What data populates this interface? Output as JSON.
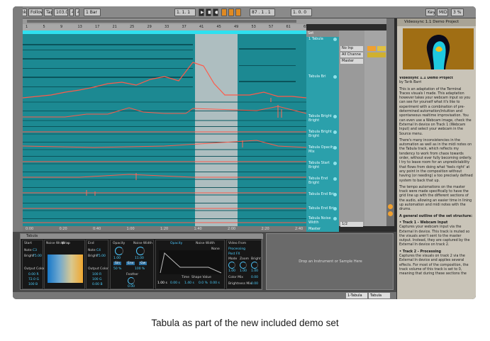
{
  "toolbar": {
    "link": "Link",
    "follow": "Follow",
    "tap": "Tap",
    "tempo": "103.00",
    "sig_num": "4",
    "sig_den": "4",
    "quant": "1 Bar",
    "pos": "1.  1.  1",
    "pos2": "87 .  1 .  1",
    "loop_len": "1.  0.  0",
    "key": "Key",
    "midi": "MIDI",
    "cpu": "3 %"
  },
  "arrangement": {
    "ruler": [
      "1",
      "5",
      "9",
      "13",
      "17",
      "21",
      "25",
      "29",
      "33",
      "37",
      "41",
      "45",
      "49",
      "53",
      "57",
      "61",
      "65"
    ],
    "timeline": [
      "0:00",
      "0:20",
      "0:40",
      "1:00",
      "1:20",
      "1:40",
      "2:00",
      "2:20",
      "2:40"
    ],
    "set_label": "Set",
    "tracks": [
      {
        "name": "1 Tabula",
        "input": "No Inp",
        "channel": "All Channe"
      },
      {
        "name": "Tabula Bri",
        "input": "",
        "channel": ""
      },
      {
        "name": "Tabula Bright Bright",
        "input": "",
        "channel": ""
      },
      {
        "name": "Tabula Bright Bright",
        "input": "",
        "channel": ""
      },
      {
        "name": "Tabula Opacity Mix",
        "input": "",
        "channel": ""
      },
      {
        "name": "Tabula Start Bright",
        "input": "",
        "channel": ""
      },
      {
        "name": "Tabula End Bright",
        "input": "",
        "channel": ""
      },
      {
        "name": "Tabula End Bri",
        "input": "",
        "channel": ""
      },
      {
        "name": "Tabula End Bri",
        "input": "",
        "channel": ""
      },
      {
        "name": "Tabula Noise Width",
        "input": "",
        "channel": ""
      }
    ],
    "monitor": "Master",
    "none": "None",
    "master_label": "Master",
    "master_val": "1/2"
  },
  "help": {
    "title": "Videosync 1.1 Demo Project",
    "heading": "Videosync 1.1 Demo Project",
    "byline": "by Tarik Barri",
    "paragraphs": [
      "This is an adaptation of the Terminal Traces visuals I made. This adaptation however takes your webcam input so you can see for yourself what it's like to experiment with a combination of pre-determined automation/intuition and spontaneous realtime improvisation. You can even use a Webcam image, check the External In device on Track 1 (Webcam Input) and select your webcam in the Source menu.",
      "There's many inconsistencies in the automation as well as in the midi notes on the Tabula track, which reflects my tendency to work from chaos towards order, without ever fully becoming orderly. I try to leave room for an unpredictability that flows from doing what 'feels right' at any point in the composition without having (or needing) a too precisely defined system to back that up.",
      "The tempo automations on the master track were made specifically to have the grid line up with the different sections of the audio, allowing an easier time in lining up automation and midi notes with the drums.",
      "A general outline of the set structure:",
      "• Track 1 - Webcam Input",
      "Captures your webcam input via the External In device. This track is muted so the visuals aren't sent to the master output. Instead, they are captured by the External In device on track 2.",
      "• Track 2 - Processing",
      "Captures the visuals on track 2 via the External In device and applies several effects. For most of the composition, the track volume of this track is set to 0, meaning that during these sections the"
    ]
  },
  "device": {
    "name": "Tabula",
    "start": {
      "title": "Start",
      "note_lbl": "Note",
      "note_val": "C3",
      "bright_lbl": "Bright",
      "bright_val": "75.00",
      "out_color": "Output Color",
      "r": "0.00 R",
      "g": "72.0 G",
      "b": "100 B"
    },
    "noise": {
      "title": "Noise Wrap",
      "wrap": "Wrap"
    },
    "end": {
      "title": "End",
      "note_lbl": "Note",
      "note_val": "C4",
      "bright_lbl": "Bright",
      "bright_val": "75.00",
      "out_color": "Output Color",
      "r": "100 R",
      "g": "100 G",
      "b": "0.00 B"
    },
    "opacity": {
      "title": "Opacity",
      "val": "1.00",
      "noise_title": "Noise Width",
      "noise_val": "1.00"
    },
    "bars": {
      "title": "Envelope"
    },
    "tilt": {
      "val": "11.00",
      "btn1": "Sin",
      "btn2": "Env",
      "btn3": "Gw",
      "pct": "100 %",
      "rev": "50 %",
      "feather": "Feather",
      "feather_val": "0.00"
    },
    "envelope": {
      "title": "Opacity",
      "noise_title": "Noise Width",
      "none": "None",
      "time": "Time",
      "shape": "Shape Value",
      "v1": "1.00 s",
      "v2": "0.00 s",
      "v3": "1.40 s",
      "v4": "0.0 %",
      "v5": "0.00 s"
    },
    "video_from": {
      "title": "Video From",
      "opt1": "Processing",
      "opt2": "Post FX",
      "mode": "Mode",
      "zoom": "Zoom",
      "bright": "Bright",
      "mode_val": "1.00",
      "zoom_val": "1.00",
      "bright_val": "1.00"
    },
    "color_mix": {
      "lbl": "Color Mix",
      "val": "0.00",
      "bright_lbl": "Brightness Mix",
      "bright_val": "0.00"
    }
  },
  "drop": "Drop an Instrument or Sample Here",
  "status": {
    "track": "1-Tabula",
    "device": "Tabula"
  },
  "caption": "Tabula as part of the new included demo set"
}
